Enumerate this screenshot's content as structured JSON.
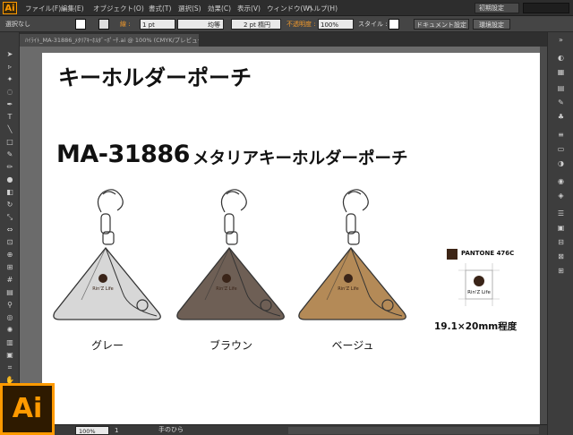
{
  "app": {
    "icon_label": "Ai",
    "menu": [
      "ファイル(F)",
      "編集(E)",
      "オブジェクト(O)",
      "書式(T)",
      "選択(S)",
      "効果(C)",
      "表示(V)",
      "ウィンドウ(W)",
      "ヘルプ(H)"
    ],
    "workspace": "初期設定"
  },
  "controlbar": {
    "selection": "選択なし",
    "stroke_label": "線 :",
    "stroke_weight": "1 pt",
    "stroke_style": "均等",
    "brush": "2 pt 楕円",
    "opacity_label": "不透明度 :",
    "opacity": "100%",
    "style_label": "スタイル :",
    "doc_settings": "ドキュメント設定",
    "env_settings": "環境設定"
  },
  "document": {
    "tab": "ﾊｲﾗｲﾄ_MA-31886_ﾒﾀﾘｱｷｰﾎﾙﾀﾞｰﾎﾟｰﾁ.ai @ 100% (CMYK/プレビュー)"
  },
  "artboard": {
    "title": "キーホルダーポーチ",
    "model": "MA-31886",
    "product_name": "メタリアキーホルダーポーチ",
    "logo_text": "Rin'Z Life",
    "variants": [
      {
        "label": "グレー",
        "color": "#d7d7d7"
      },
      {
        "label": "ブラウン",
        "color": "#6e5f55"
      },
      {
        "label": "ベージュ",
        "color": "#b48a57"
      }
    ],
    "pantone": "PANTONE 476C",
    "pantone_color": "#3d2516",
    "logo_size": "19.1×20mm程度"
  },
  "status": {
    "zoom": "100%",
    "page": "1",
    "tool": "手のひら"
  }
}
